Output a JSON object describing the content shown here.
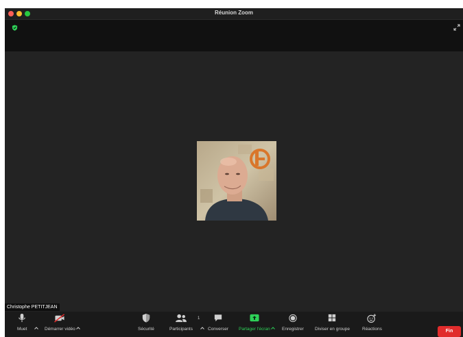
{
  "window": {
    "title": "Réunion Zoom"
  },
  "participant": {
    "name": "Christophe PETITJEAN"
  },
  "toolbar": {
    "mute_label": "Muet",
    "video_label": "Démarrer vidéo",
    "security_label": "Sécurité",
    "participants_label": "Participants",
    "participants_count": "1",
    "chat_label": "Converser",
    "share_label": "Partager l'écran",
    "record_label": "Enregistrer",
    "breakout_label": "Diviser en groupe",
    "reactions_label": "Réactions",
    "end_label": "Fin"
  },
  "colors": {
    "end_button": "#e12c2c",
    "share_accent": "#2ed158",
    "security_shield": "#2ed158"
  },
  "icons": {
    "security": "shield-icon",
    "fullscreen": "fullscreen-icon",
    "mic": "microphone-icon",
    "video": "video-camera-off-icon",
    "security_toolbar": "security-shield-icon",
    "participants": "participants-icon",
    "chat": "chat-bubble-icon",
    "share": "share-screen-icon",
    "record": "record-icon",
    "breakout": "breakout-rooms-icon",
    "reactions": "reactions-icon"
  }
}
